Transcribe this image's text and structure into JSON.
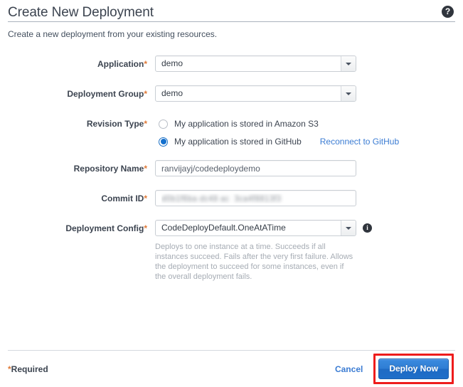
{
  "header": {
    "title": "Create New Deployment",
    "subtitle": "Create a new deployment from your existing resources.",
    "help_icon": "question-mark-icon",
    "help_glyph": "?"
  },
  "form": {
    "application": {
      "label": "Application",
      "required_mark": "*",
      "value": "demo"
    },
    "deployment_group": {
      "label": "Deployment Group",
      "required_mark": "*",
      "value": "demo"
    },
    "revision_type": {
      "label": "Revision Type",
      "required_mark": "*",
      "options": [
        {
          "label": "My application is stored in Amazon S3",
          "selected": false
        },
        {
          "label": "My application is stored in GitHub",
          "selected": true
        }
      ],
      "link_label": "Reconnect to GitHub"
    },
    "repository_name": {
      "label": "Repository Name",
      "required_mark": "*",
      "value": "ranvijayj/codedeploydemo",
      "placeholder": ""
    },
    "commit_id": {
      "label": "Commit ID",
      "required_mark": "*",
      "value": "d0b1f6ba dc48 ac  3ca4f8813f3",
      "placeholder": ""
    },
    "deployment_config": {
      "label": "Deployment Config",
      "required_mark": "*",
      "value": "CodeDeployDefault.OneAtATime",
      "info_icon": "info-icon",
      "info_glyph": "i",
      "help_text": "Deploys to one instance at a time. Succeeds if all instances succeed. Fails after the very first failure. Allows the deployment to succeed for some instances, even if the overall deployment fails."
    }
  },
  "footer": {
    "required_note_star": "*",
    "required_note": "Required",
    "cancel_label": "Cancel",
    "deploy_label": "Deploy Now"
  },
  "colors": {
    "accent_blue": "#3b7cd3",
    "button_blue": "#2f7ed4",
    "highlight_red": "#ee1c1c",
    "required_orange": "#e07b39",
    "text_dark": "#3c4450",
    "help_text_gray": "#a6acb4"
  }
}
